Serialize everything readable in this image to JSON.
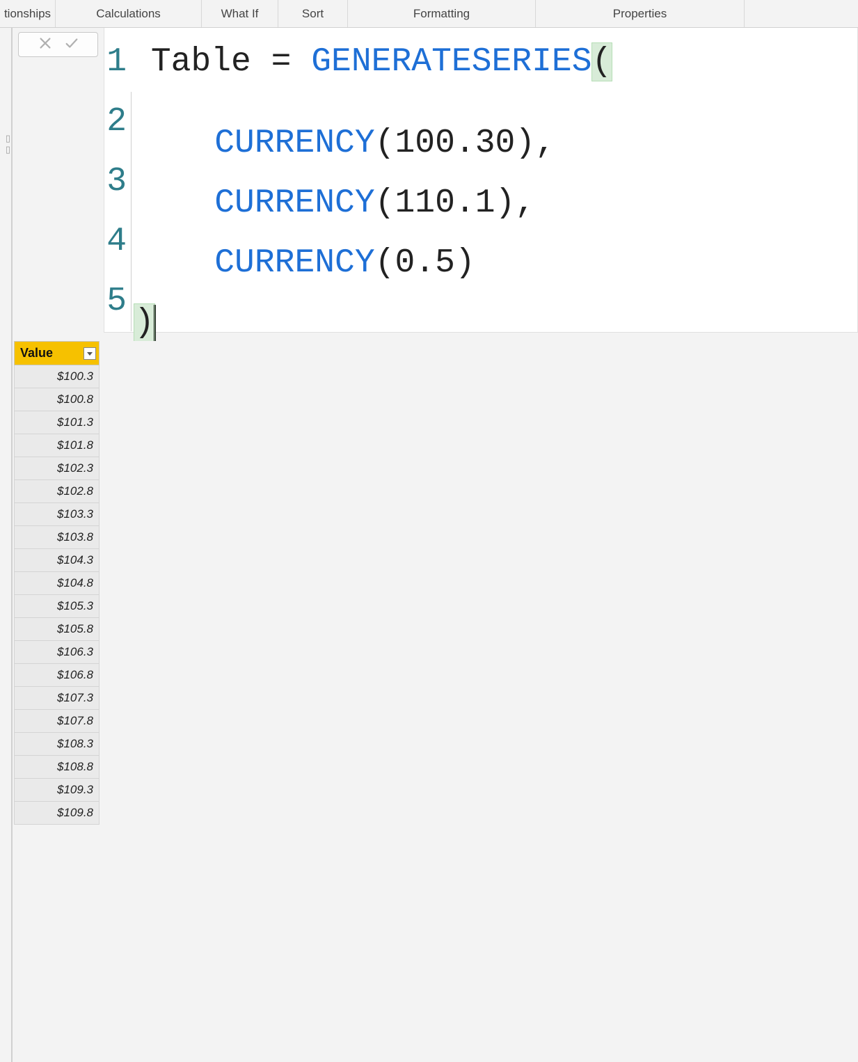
{
  "ribbon": {
    "groups": [
      "tionships",
      "Calculations",
      "What If",
      "Sort",
      "Formatting",
      "Properties"
    ]
  },
  "editor": {
    "lines": [
      {
        "num": "1",
        "segs": [
          {
            "t": " ",
            "c": "plain"
          },
          {
            "t": "Table = ",
            "c": "plain"
          },
          {
            "t": "GENERATESERIES",
            "c": "func"
          },
          {
            "t": "(",
            "c": "plain",
            "hl": true
          }
        ]
      },
      {
        "num": "2",
        "indent": true,
        "segs": [
          {
            "t": "    ",
            "c": "plain"
          },
          {
            "t": "CURRENCY",
            "c": "func"
          },
          {
            "t": "(",
            "c": "plain"
          },
          {
            "t": "100.30",
            "c": "num"
          },
          {
            "t": "),",
            "c": "plain"
          }
        ]
      },
      {
        "num": "3",
        "indent": true,
        "segs": [
          {
            "t": "    ",
            "c": "plain"
          },
          {
            "t": "CURRENCY",
            "c": "func"
          },
          {
            "t": "(",
            "c": "plain"
          },
          {
            "t": "110.1",
            "c": "num"
          },
          {
            "t": "),",
            "c": "plain"
          }
        ]
      },
      {
        "num": "4",
        "indent": true,
        "segs": [
          {
            "t": "    ",
            "c": "plain"
          },
          {
            "t": "CURRENCY",
            "c": "func"
          },
          {
            "t": "(",
            "c": "plain"
          },
          {
            "t": "0.5",
            "c": "num"
          },
          {
            "t": ")",
            "c": "plain"
          }
        ]
      },
      {
        "num": "5",
        "indent": true,
        "segs": [
          {
            "t": ")",
            "c": "plain",
            "hl": true,
            "cursor": true
          }
        ]
      }
    ]
  },
  "table": {
    "header": "Value",
    "rows": [
      "$100.3",
      "$100.8",
      "$101.3",
      "$101.8",
      "$102.3",
      "$102.8",
      "$103.3",
      "$103.8",
      "$104.3",
      "$104.8",
      "$105.3",
      "$105.8",
      "$106.3",
      "$106.8",
      "$107.3",
      "$107.8",
      "$108.3",
      "$108.8",
      "$109.3",
      "$109.8"
    ]
  }
}
